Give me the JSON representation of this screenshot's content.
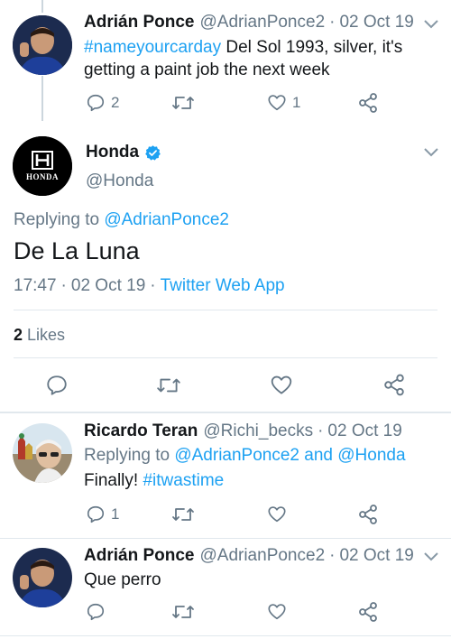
{
  "tweets": [
    {
      "name": "Adrián Ponce",
      "handle": "@AdrianPonce2",
      "sep": "·",
      "date": "02 Oct 19",
      "hashtag": "#nameyourcarday",
      "text_after_hashtag": " Del Sol 1993, silver, it's getting a paint job the next week",
      "reply_count": "2",
      "like_count": "1"
    }
  ],
  "main_tweet": {
    "name": "Honda",
    "handle": "@Honda",
    "verified": true,
    "logo_text": "HONDA",
    "replying_prefix": "Replying to ",
    "replying_to": "@AdrianPonce2",
    "text": "De La Luna",
    "time": "17:47",
    "date": "02 Oct 19",
    "sep": "·",
    "source": "Twitter Web App",
    "likes_count": "2",
    "likes_label": "Likes"
  },
  "replies": [
    {
      "name": "Ricardo Teran",
      "handle": "@Richi_becks",
      "sep": "·",
      "date": "02 Oct 19",
      "replying_prefix": "Replying to ",
      "replying_to_1": "@AdrianPonce2",
      "replying_and": " and ",
      "replying_to_2": "@Honda",
      "text": "Finally! ",
      "hashtag": "#itwastime",
      "reply_count": "1"
    },
    {
      "name": "Adrián Ponce",
      "handle": "@AdrianPonce2",
      "sep": "·",
      "date": "02 Oct 19",
      "text": "Que perro"
    }
  ],
  "colors": {
    "accent": "#1da1f2",
    "muted": "#657786",
    "icon": "#657786"
  }
}
